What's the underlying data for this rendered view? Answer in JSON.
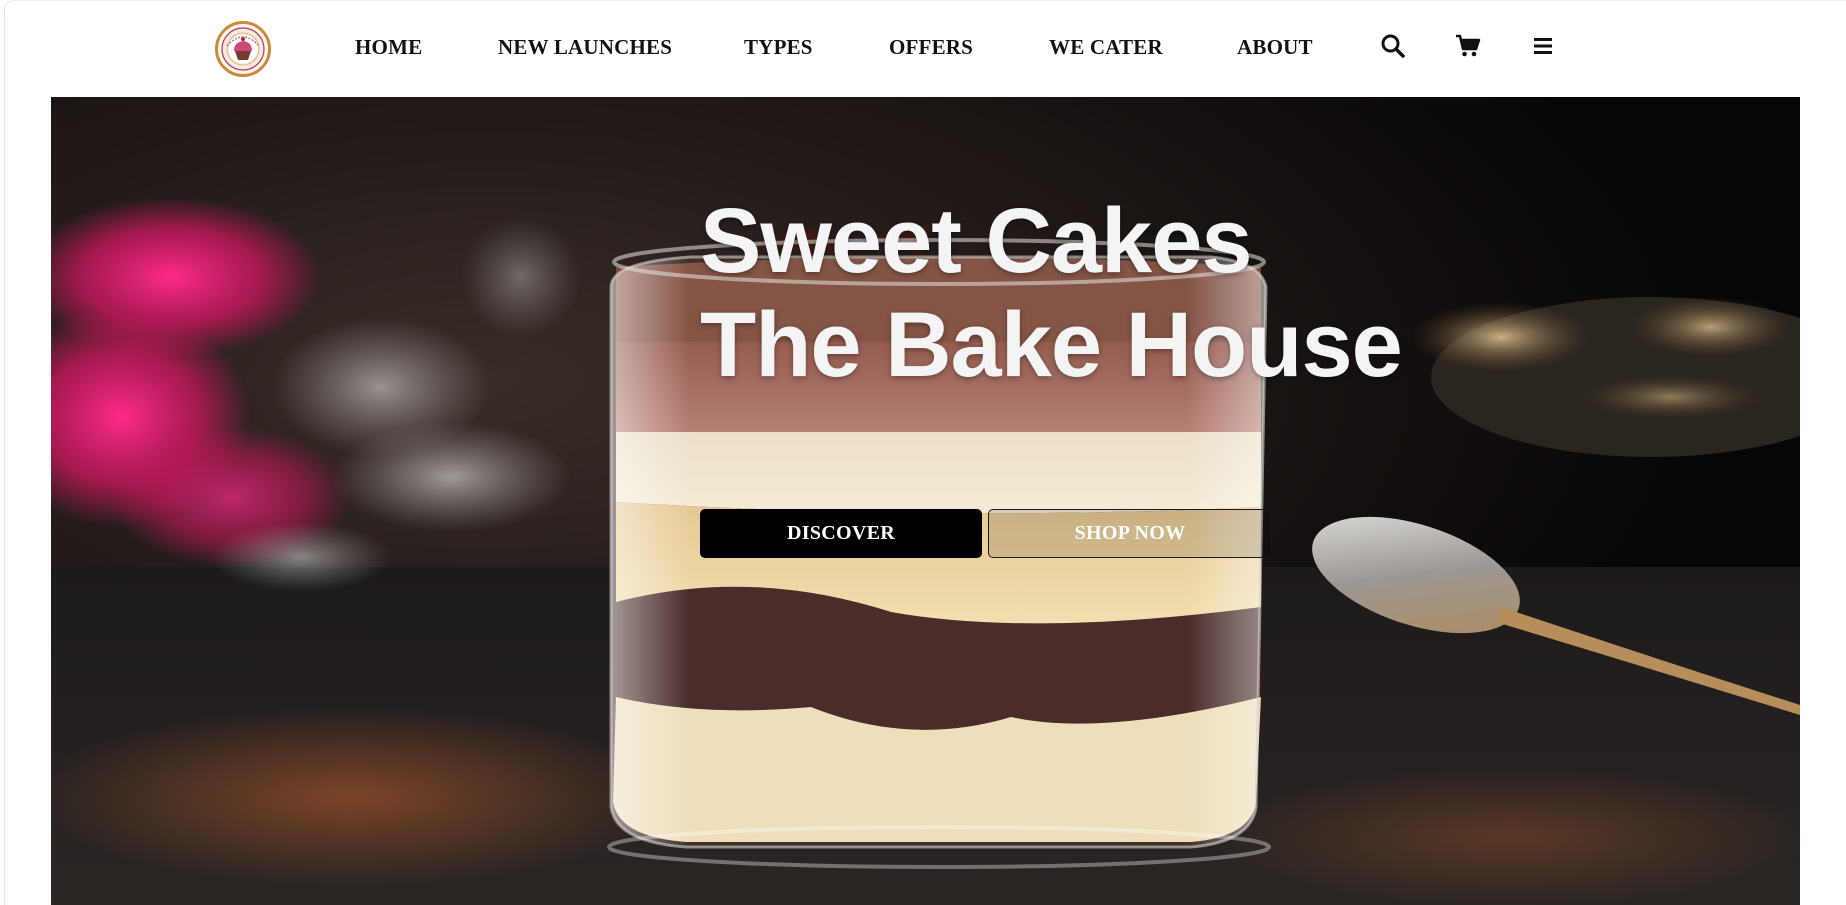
{
  "brand": {
    "logo_name": "Sweet Cakes The Bake House logo"
  },
  "nav": {
    "links": [
      {
        "label": "HOME"
      },
      {
        "label": "NEW LAUNCHES"
      },
      {
        "label": "TYPES"
      },
      {
        "label": "OFFERS"
      },
      {
        "label": "WE CATER"
      },
      {
        "label": "ABOUT"
      }
    ],
    "icons": [
      "search-icon",
      "cart-icon",
      "menu-icon"
    ]
  },
  "hero": {
    "title_line1": "Sweet Cakes",
    "title_line2": "The Bake House",
    "primary_button": "DISCOVER",
    "secondary_button": "SHOP NOW",
    "image_subject": "layered tiramisu dessert in a glass"
  },
  "colors": {
    "nav_text": "#111111",
    "hero_title": "#f4f4f4",
    "button_primary_bg": "#000000",
    "button_text": "#ffffff",
    "logo_ring": "#c98a3c"
  }
}
